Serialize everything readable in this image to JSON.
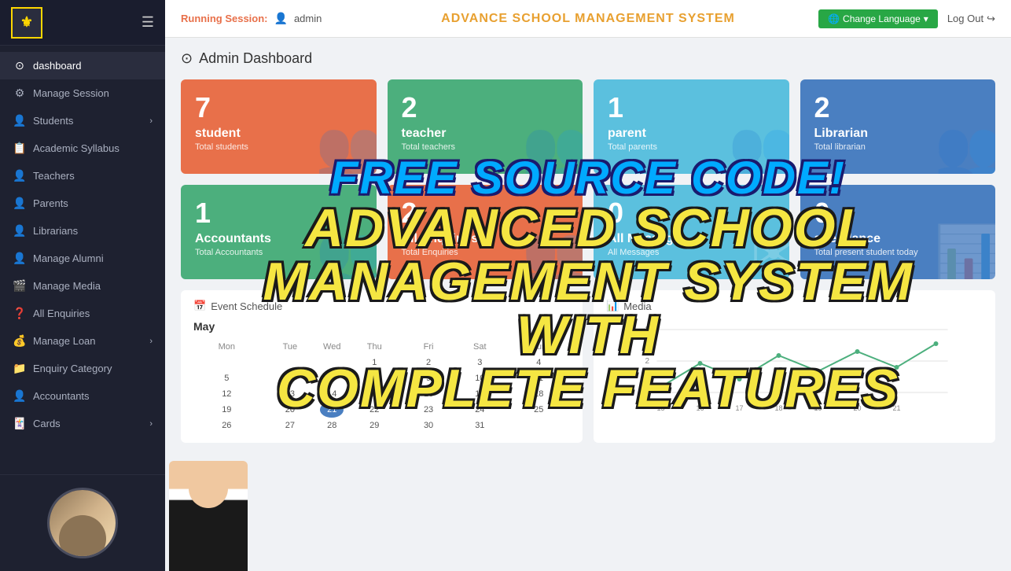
{
  "app": {
    "title": "ADVANCE SCHOOL MANAGEMENT SYSTEM"
  },
  "topbar": {
    "running_session_label": "Running Session:",
    "user": "admin",
    "change_language": "Change Language",
    "logout": "Log Out"
  },
  "sidebar": {
    "logo_text": "⚜",
    "hamburger": "☰",
    "nav_items": [
      {
        "label": "dashboard",
        "icon": "⊙",
        "active": true,
        "has_chevron": false
      },
      {
        "label": "Manage Session",
        "icon": "⚙",
        "active": false,
        "has_chevron": false
      },
      {
        "label": "Students",
        "icon": "👤",
        "active": false,
        "has_chevron": true
      },
      {
        "label": "Academic Syllabus",
        "icon": "📋",
        "active": false,
        "has_chevron": false
      },
      {
        "label": "Teachers",
        "icon": "👤",
        "active": false,
        "has_chevron": false
      },
      {
        "label": "Parents",
        "icon": "👤",
        "active": false,
        "has_chevron": false
      },
      {
        "label": "Librarians",
        "icon": "👤",
        "active": false,
        "has_chevron": false
      },
      {
        "label": "Manage Alumni",
        "icon": "👤",
        "active": false,
        "has_chevron": false
      },
      {
        "label": "Manage Media",
        "icon": "🎬",
        "active": false,
        "has_chevron": false
      },
      {
        "label": "All Enquiries",
        "icon": "❓",
        "active": false,
        "has_chevron": false
      },
      {
        "label": "Manage Loan",
        "icon": "💰",
        "active": false,
        "has_chevron": true
      },
      {
        "label": "Enquiry Category",
        "icon": "📁",
        "active": false,
        "has_chevron": false
      },
      {
        "label": "Accountants",
        "icon": "👤",
        "active": false,
        "has_chevron": false
      },
      {
        "label": "Cards",
        "icon": "🃏",
        "active": false,
        "has_chevron": true
      }
    ]
  },
  "dashboard": {
    "heading": "Admin Dashboard",
    "stat_cards": [
      {
        "number": "7",
        "label": "student",
        "sub": "Total students",
        "color": "orange",
        "icon": "👥"
      },
      {
        "number": "2",
        "label": "teacher",
        "sub": "Total teachers",
        "color": "green",
        "icon": "👥"
      },
      {
        "number": "1",
        "label": "parent",
        "sub": "Total parents",
        "color": "light-blue",
        "icon": "👥"
      },
      {
        "number": "2",
        "label": "Librarian",
        "sub": "Total librarian",
        "color": "blue",
        "icon": "👥"
      },
      {
        "number": "1",
        "label": "Accountants",
        "sub": "Total Accountants",
        "color": "green2",
        "icon": "👥"
      },
      {
        "number": "2",
        "label": "All Enquiries",
        "sub": "Total Enquiries",
        "color": "orange2",
        "icon": "👥"
      },
      {
        "number": "0",
        "label": "All Messages",
        "sub": "All Messages",
        "color": "teal",
        "icon": "✉"
      },
      {
        "number": "0",
        "label": "attendance",
        "sub": "Total present student today",
        "color": "blue2",
        "icon": "📊"
      }
    ],
    "event_schedule_title": "Event Schedule",
    "calendar_month": "May",
    "calendar_days": [
      "Mon",
      "Tue",
      "Wed",
      "Thu",
      "Fri",
      "Sat",
      "Sun"
    ],
    "calendar_rows": [
      [
        "",
        "",
        "",
        "1",
        "2",
        "3",
        "4"
      ],
      [
        "5",
        "6",
        "7",
        "8",
        "9",
        "10",
        "11"
      ],
      [
        "12",
        "13",
        "14",
        "15",
        "16",
        "17",
        "18"
      ],
      [
        "19",
        "20",
        "21",
        "22",
        "23",
        "24",
        "25"
      ],
      [
        "26",
        "27",
        "28",
        "29",
        "30",
        "31",
        ""
      ]
    ],
    "today": "21",
    "chart_title": "Media",
    "chart_y_labels": [
      "3",
      "2",
      "1"
    ],
    "chart_x_labels": [
      "15",
      "16",
      "17",
      "18",
      "19",
      "20",
      "21"
    ]
  },
  "overlay": {
    "line1": "FREE SOURCE CODE!",
    "line2": "ADVANCED SCHOOL",
    "line3": "MANAGEMENT SYSTEM",
    "line4": "WITH",
    "line5": "COMPLETE FEATURES"
  }
}
